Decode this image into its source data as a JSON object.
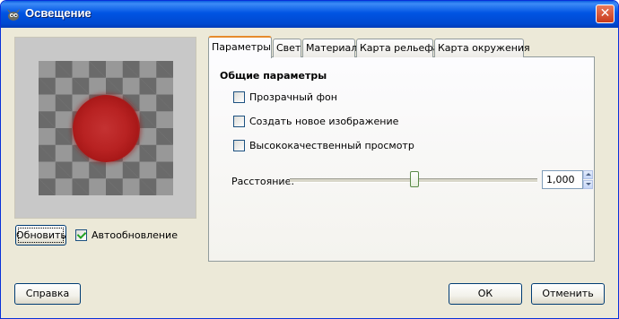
{
  "window": {
    "title": "Освещение",
    "close_symbol": "✕"
  },
  "preview": {
    "refresh_label": "Обновить",
    "auto_update_label": "Автообновление",
    "auto_update_checked": true
  },
  "tabs": [
    {
      "label": "Параметры",
      "active": true
    },
    {
      "label": "Свет",
      "active": false
    },
    {
      "label": "Материал",
      "active": false
    },
    {
      "label": "Карта рельефа",
      "active": false
    },
    {
      "label": "Карта окружения",
      "active": false
    }
  ],
  "general": {
    "title": "Общие параметры",
    "options": [
      {
        "label": "Прозрачный фон",
        "checked": false
      },
      {
        "label": "Создать новое изображение",
        "checked": false
      },
      {
        "label": "Высококачественный просмотр",
        "checked": false
      }
    ],
    "distance_label": "Расстояние:",
    "distance_value": "1,000",
    "distance_slider_fraction": 0.49
  },
  "buttons": {
    "help": "Справка",
    "ok": "ОК",
    "cancel": "Отменить"
  },
  "colors": {
    "titlebar": "#0054e3",
    "active_tab_accent": "#e68b2c",
    "sphere": "#b82222"
  },
  "icons": {
    "window": "gimp-icon",
    "close": "close-icon",
    "spin_up": "spin-up-icon",
    "spin_down": "spin-down-icon"
  }
}
